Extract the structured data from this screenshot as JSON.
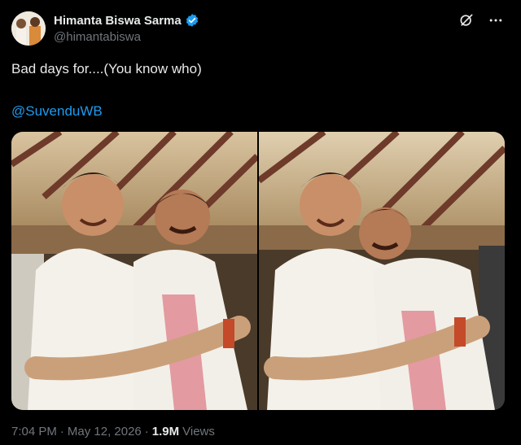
{
  "author": {
    "display_name": "Himanta Biswa Sarma",
    "handle": "@himantabiswa",
    "verified": true
  },
  "tweet": {
    "text": "Bad days for....(You know who)",
    "mention": "@SuvenduWB"
  },
  "media": [
    {
      "label": "photo-1"
    },
    {
      "label": "photo-2"
    }
  ],
  "meta": {
    "time": "7:04 PM",
    "separator1": "·",
    "date": "May 12, 2026",
    "separator2": "·",
    "views_count": "1.9M",
    "views_label": "Views"
  },
  "colors": {
    "background": "#000000",
    "text": "#e7e9ea",
    "muted": "#71767b",
    "accent": "#1d9bf0"
  },
  "icons": {
    "verified": "verified-badge-icon",
    "grok": "grok-icon",
    "more": "more-icon"
  }
}
